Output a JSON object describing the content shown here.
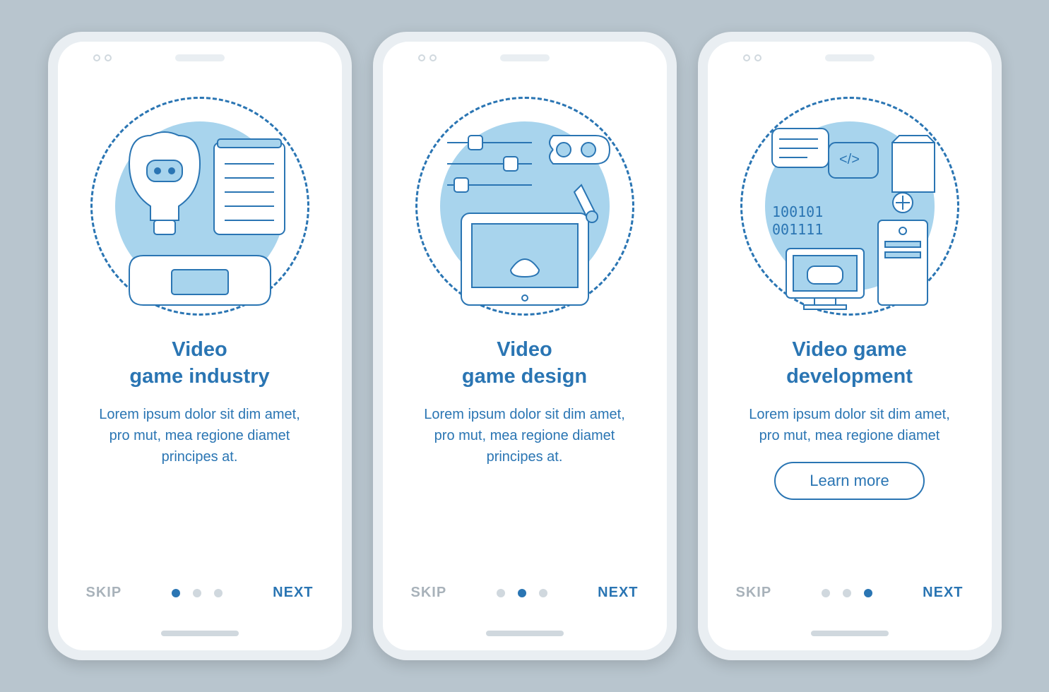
{
  "screens": [
    {
      "title": "Video\ngame industry",
      "desc": "Lorem ipsum dolor sit dim amet, pro mut, mea regione diamet principes at.",
      "skip": "SKIP",
      "next": "NEXT",
      "activeDot": 0,
      "hasLearnMore": false
    },
    {
      "title": "Video\ngame design",
      "desc": "Lorem ipsum dolor sit dim amet, pro mut, mea regione diamet principes at.",
      "skip": "SKIP",
      "next": "NEXT",
      "activeDot": 1,
      "hasLearnMore": false
    },
    {
      "title": "Video game\ndevelopment",
      "desc": "Lorem ipsum dolor sit dim amet, pro mut, mea regione diamet",
      "skip": "SKIP",
      "next": "NEXT",
      "activeDot": 2,
      "hasLearnMore": true,
      "learnMore": "Learn more"
    }
  ]
}
